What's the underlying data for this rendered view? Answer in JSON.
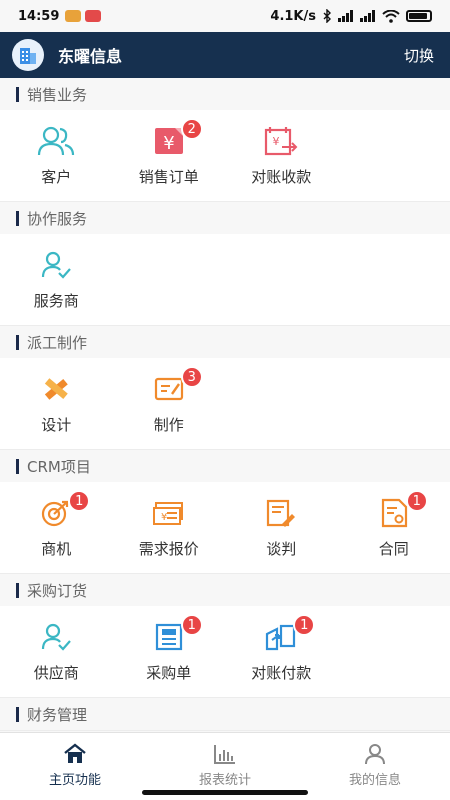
{
  "status": {
    "time": "14:59",
    "speed": "4.1K/s",
    "network": "4G"
  },
  "header": {
    "title": "东曜信息",
    "switch_label": "切换"
  },
  "sections": [
    {
      "title": "销售业务",
      "items": [
        {
          "label": "客户",
          "icon": "customers-icon",
          "badge": null
        },
        {
          "label": "销售订单",
          "icon": "sales-order-icon",
          "badge": "2"
        },
        {
          "label": "对账收款",
          "icon": "reconcile-receipt-icon",
          "badge": null
        }
      ]
    },
    {
      "title": "协作服务",
      "items": [
        {
          "label": "服务商",
          "icon": "service-provider-icon",
          "badge": null
        }
      ]
    },
    {
      "title": "派工制作",
      "items": [
        {
          "label": "设计",
          "icon": "design-icon",
          "badge": null
        },
        {
          "label": "制作",
          "icon": "production-icon",
          "badge": "3"
        }
      ]
    },
    {
      "title": "CRM项目",
      "items": [
        {
          "label": "商机",
          "icon": "opportunity-target-icon",
          "badge": "1"
        },
        {
          "label": "需求报价",
          "icon": "quote-icon",
          "badge": null
        },
        {
          "label": "谈判",
          "icon": "negotiation-icon",
          "badge": null
        },
        {
          "label": "合同",
          "icon": "contract-icon",
          "badge": "1"
        }
      ]
    },
    {
      "title": "采购订货",
      "items": [
        {
          "label": "供应商",
          "icon": "supplier-icon",
          "badge": null
        },
        {
          "label": "采购单",
          "icon": "purchase-order-icon",
          "badge": "1"
        },
        {
          "label": "对账付款",
          "icon": "reconcile-payment-icon",
          "badge": "1"
        }
      ]
    },
    {
      "title": "财务管理",
      "items": []
    }
  ],
  "tabs": [
    {
      "label": "主页功能",
      "icon": "home-icon",
      "active": true
    },
    {
      "label": "报表统计",
      "icon": "bar-chart-icon",
      "active": false
    },
    {
      "label": "我的信息",
      "icon": "user-icon",
      "active": false
    }
  ],
  "colors": {
    "header_bg": "#16304f",
    "badge": "#e84545",
    "teal": "#3bb7c4",
    "orange": "#f08a2c",
    "red": "#e85a6a"
  }
}
